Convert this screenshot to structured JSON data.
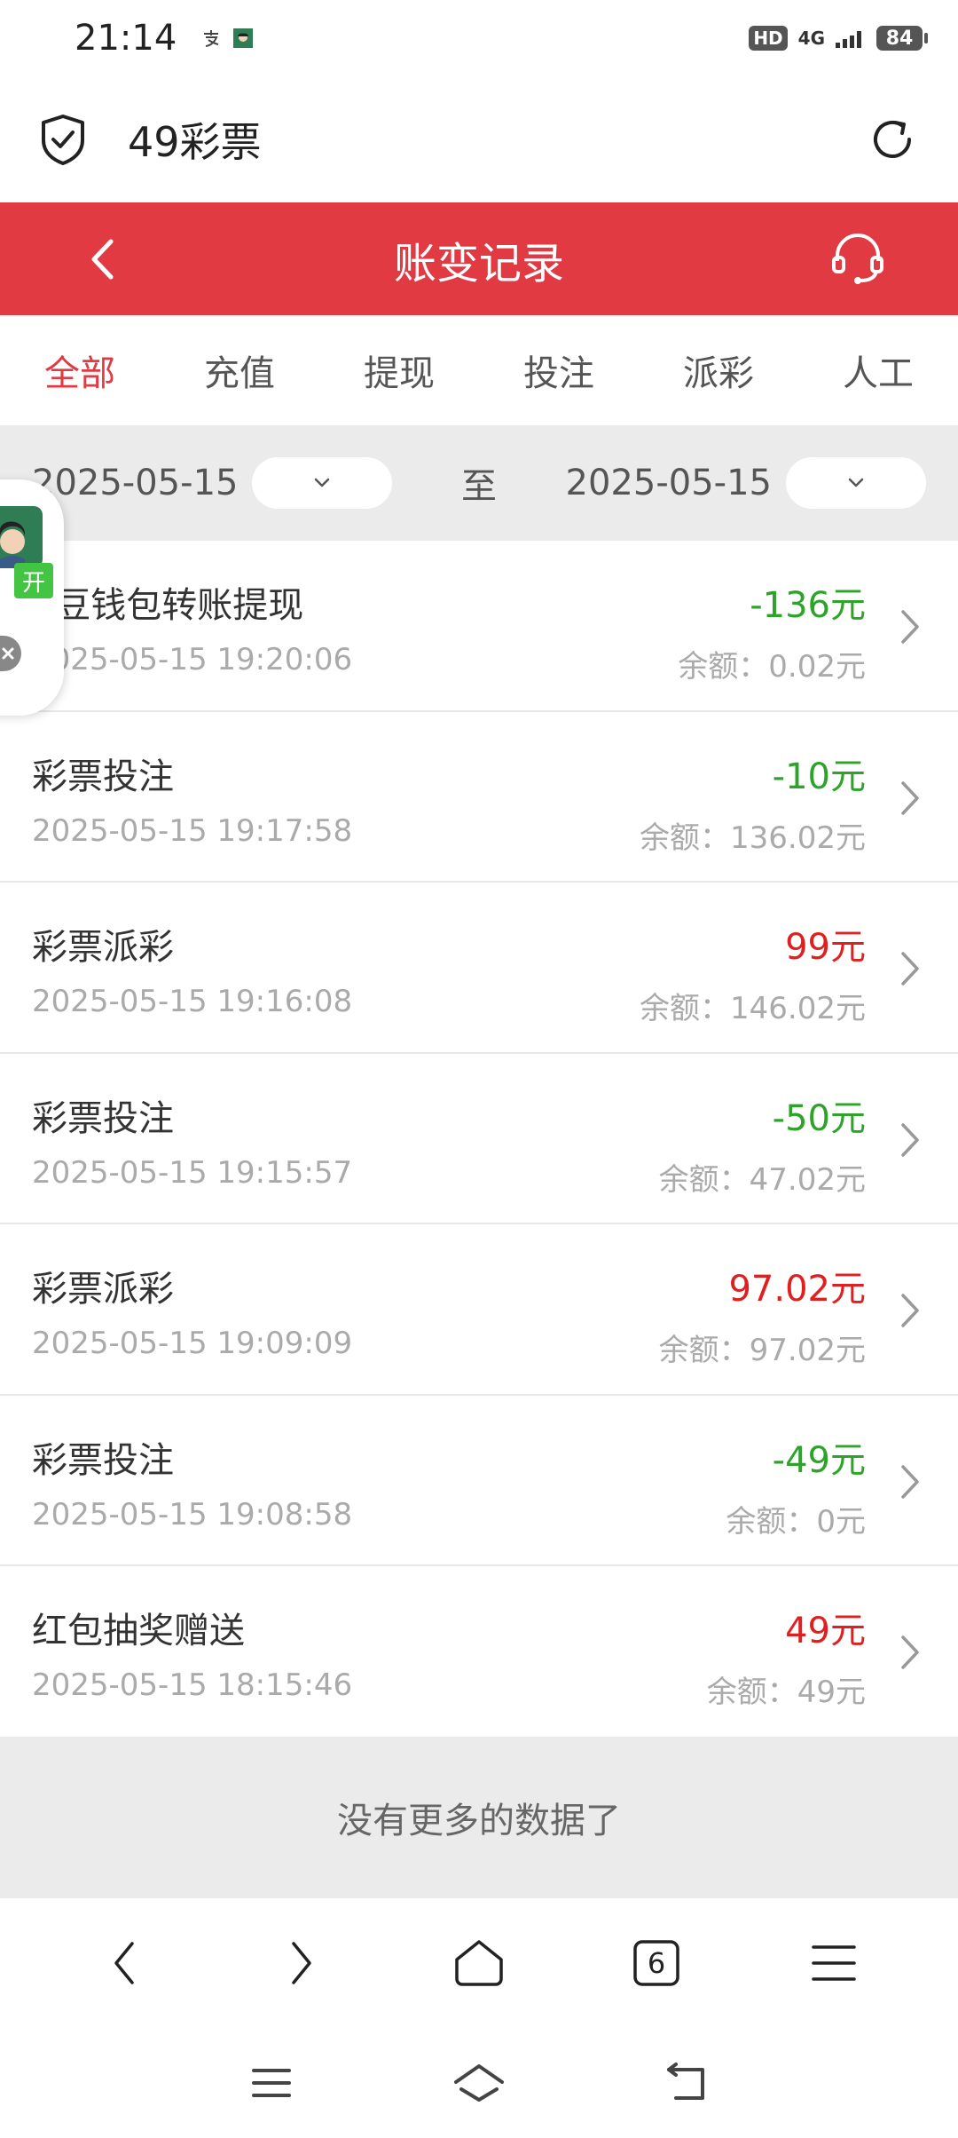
{
  "status_bar": {
    "time": "21:14",
    "hd": "HD",
    "network": "4G",
    "battery": "84"
  },
  "browser": {
    "site_title": "49彩票"
  },
  "header": {
    "title": "账变记录"
  },
  "tabs": [
    {
      "label": "全部",
      "active": true
    },
    {
      "label": "充值",
      "active": false
    },
    {
      "label": "提现",
      "active": false
    },
    {
      "label": "投注",
      "active": false
    },
    {
      "label": "派彩",
      "active": false
    },
    {
      "label": "人工",
      "active": false
    }
  ],
  "date_filter": {
    "start": "2025-05-15",
    "separator": "至",
    "end": "2025-05-15"
  },
  "records": [
    {
      "name": "K豆钱包转账提现",
      "time": "2025-05-15 19:20:06",
      "amount": "-136元",
      "sign": "neg",
      "balance": "余额：0.02元"
    },
    {
      "name": "彩票投注",
      "time": "2025-05-15 19:17:58",
      "amount": "-10元",
      "sign": "neg",
      "balance": "余额：136.02元"
    },
    {
      "name": "彩票派彩",
      "time": "2025-05-15 19:16:08",
      "amount": "99元",
      "sign": "pos",
      "balance": "余额：146.02元"
    },
    {
      "name": "彩票投注",
      "time": "2025-05-15 19:15:57",
      "amount": "-50元",
      "sign": "neg",
      "balance": "余额：47.02元"
    },
    {
      "name": "彩票派彩",
      "time": "2025-05-15 19:09:09",
      "amount": "97.02元",
      "sign": "pos",
      "balance": "余额：97.02元"
    },
    {
      "name": "彩票投注",
      "time": "2025-05-15 19:08:58",
      "amount": "-49元",
      "sign": "neg",
      "balance": "余额：0元"
    },
    {
      "name": "红包抽奖赠送",
      "time": "2025-05-15 18:15:46",
      "amount": "49元",
      "sign": "pos",
      "balance": "余额：49元"
    }
  ],
  "footer_message": "没有更多的数据了",
  "float_widget": {
    "open_label": "开"
  },
  "browser_toolbar": {
    "tab_count": "6"
  },
  "colors": {
    "accent": "#e23a43",
    "negative": "#2da329",
    "positive": "#e02020"
  }
}
